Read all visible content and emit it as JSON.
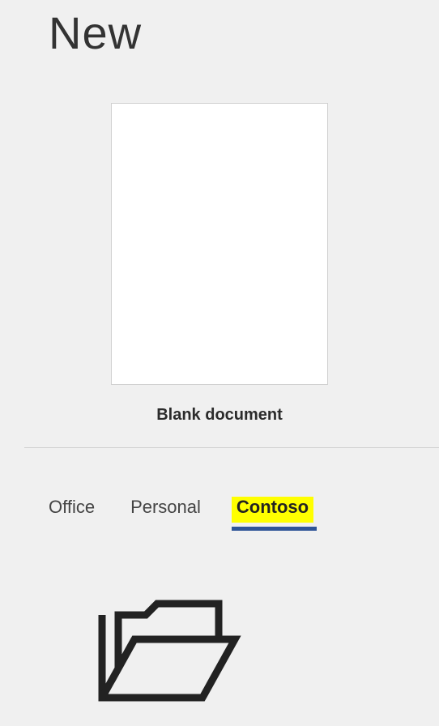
{
  "header": {
    "title": "New"
  },
  "templates": [
    {
      "label": "Blank document"
    }
  ],
  "tabs": [
    {
      "label": "Office",
      "active": false,
      "highlighted": false
    },
    {
      "label": "Personal",
      "active": false,
      "highlighted": false
    },
    {
      "label": "Contoso",
      "active": true,
      "highlighted": true
    }
  ],
  "icons": {
    "folder": "folder-open-icon"
  }
}
